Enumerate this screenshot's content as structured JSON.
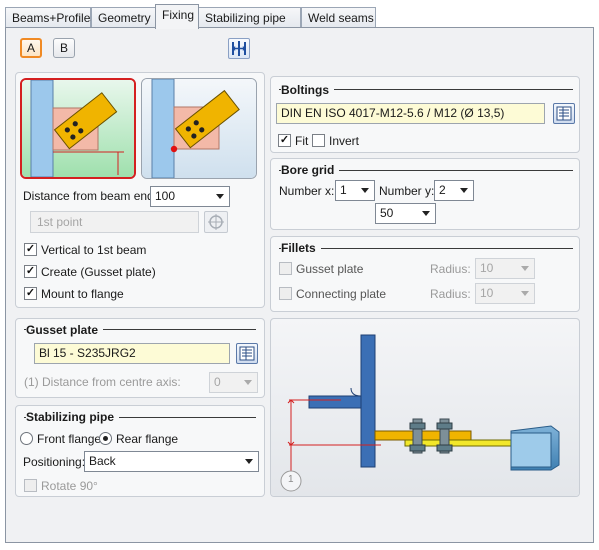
{
  "tabs": [
    {
      "label": "Beams+Profiles"
    },
    {
      "label": "Geometry"
    },
    {
      "label": "Fixing"
    },
    {
      "label": "Stabilizing pipe"
    },
    {
      "label": "Weld seams"
    }
  ],
  "variant": {
    "a": "A",
    "b": "B"
  },
  "connection": {
    "distance_label": "Distance from beam end:",
    "distance_value": "100",
    "point_placeholder": "1st point",
    "vertical_label": "Vertical to 1st beam",
    "create_label": "Create (Gusset plate)",
    "mount_label": "Mount to flange"
  },
  "gusset": {
    "title": "Gusset plate",
    "value": "Bl 15 - S235JRG2",
    "distance_label": "(1) Distance from centre axis:",
    "distance_value": "0"
  },
  "pipe": {
    "title": "Stabilizing pipe",
    "front_label": "Front flange",
    "rear_label": "Rear flange",
    "positioning_label": "Positioning:",
    "positioning_value": "Back",
    "rotate_label": "Rotate 90°"
  },
  "boltings": {
    "title": "Boltings",
    "value": "DIN EN ISO 4017-M12-5.6 / M12 (Ø 13,5)",
    "fit_label": "Fit",
    "invert_label": "Invert"
  },
  "bore": {
    "title": "Bore grid",
    "number_x_label": "Number x:",
    "number_x": "1",
    "number_y_label": "Number y:",
    "number_y": "2",
    "spacing": "50"
  },
  "fillets": {
    "title": "Fillets",
    "gusset_label": "Gusset plate",
    "connecting_label": "Connecting plate",
    "radius_label": "Radius:",
    "radius1": "10",
    "radius2": "10"
  },
  "preview": {
    "marker": "1"
  },
  "colors": {
    "accent_orange": "#f08a24",
    "beam_blue": "#9cc8ec",
    "plate_yellow": "#f0b400",
    "selection_red": "#d42020"
  }
}
